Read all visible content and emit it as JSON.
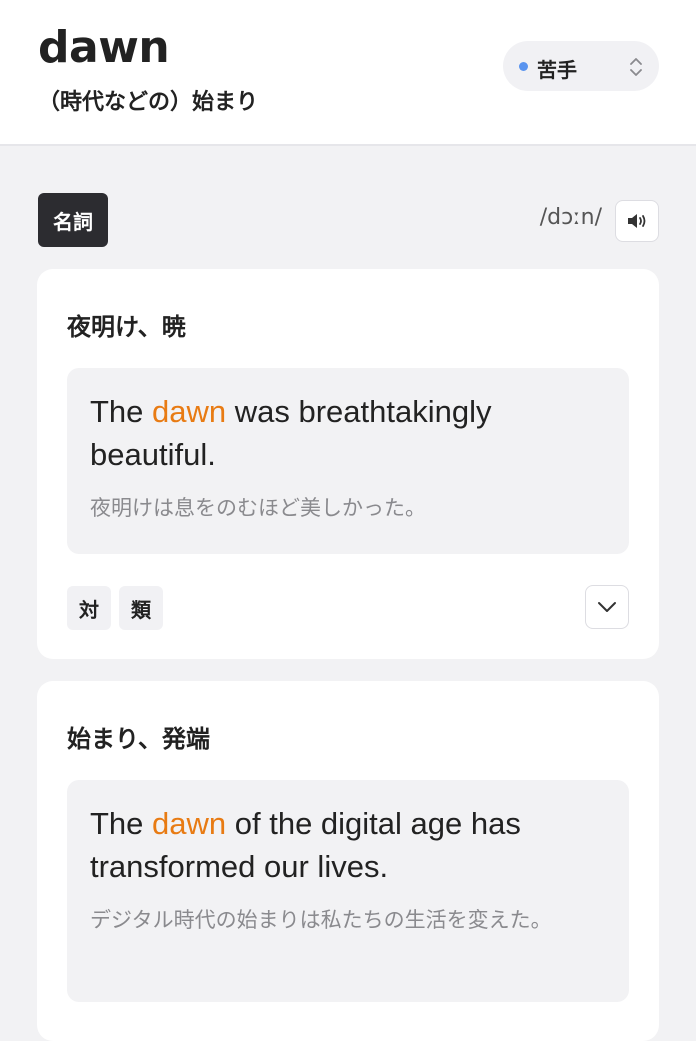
{
  "header": {
    "word": "dawn",
    "meaning": "（時代などの）始まり",
    "level": {
      "label": "苦手",
      "dot_color": "#5a94ef",
      "icon": "up-down-chevron-icon"
    }
  },
  "part_of_speech": "名詞",
  "pronunciation": "/dɔːn/",
  "speaker_icon": "speaker-icon",
  "accent_color": "#e87b13",
  "senses": [
    {
      "title": "夜明け、暁",
      "example": {
        "en_before": "The ",
        "en_highlight": "dawn",
        "en_after": " was breathtakingly beautiful.",
        "ja": "夜明けは息をのむほど美しかった。"
      },
      "tags": [
        "対",
        "類"
      ],
      "expand_icon": "chevron-down-icon"
    },
    {
      "title": "始まり、発端",
      "example": {
        "en_before": "The ",
        "en_highlight": "dawn",
        "en_after": " of the digital age has transformed our lives.",
        "ja": "デジタル時代の始まりは私たちの生活を変えた。"
      }
    }
  ]
}
